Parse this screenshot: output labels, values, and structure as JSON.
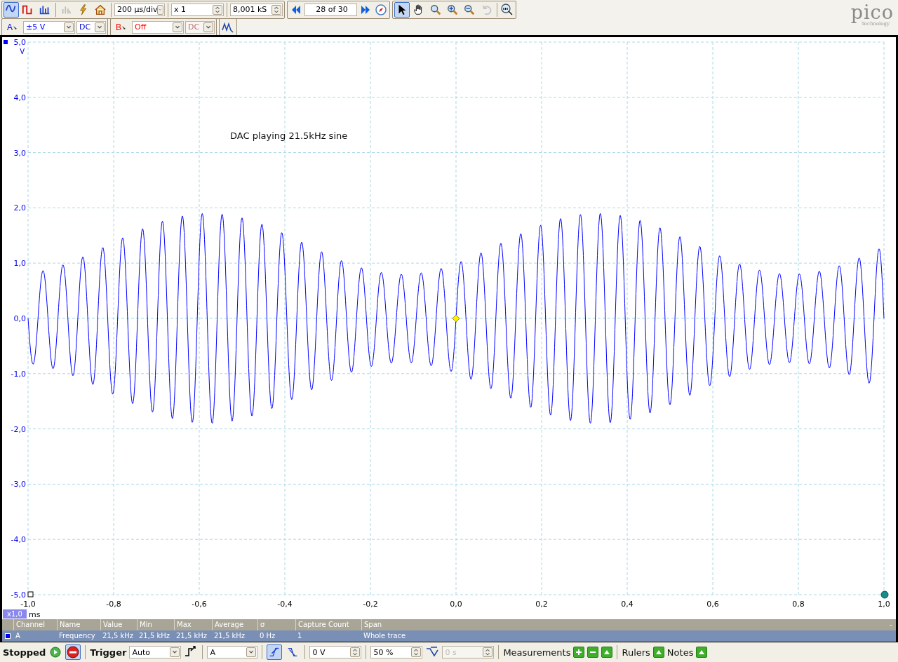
{
  "toolbar": {
    "view_modes": [
      {
        "kind": "scope",
        "selected": true
      },
      {
        "kind": "persistence",
        "selected": false
      },
      {
        "kind": "spectrum",
        "selected": false
      }
    ],
    "tools_a": [
      {
        "kind": "probe",
        "disabled": true
      },
      {
        "kind": "autosetup",
        "disabled": false
      },
      {
        "kind": "home",
        "disabled": false
      }
    ],
    "timebase": "200 µs/div",
    "zoom": "x 1",
    "samples": "8,001 kS",
    "capture": "28 of 30",
    "cursor_tools": [
      {
        "kind": "pointer",
        "selected": true,
        "disabled": false
      },
      {
        "kind": "hand",
        "selected": false,
        "disabled": false
      },
      {
        "kind": "zoom_area",
        "selected": false,
        "disabled": false
      },
      {
        "kind": "zoom_in",
        "selected": false,
        "disabled": false
      },
      {
        "kind": "zoom_out",
        "selected": false,
        "disabled": false
      },
      {
        "kind": "undo",
        "selected": false,
        "disabled": true
      }
    ]
  },
  "logo": {
    "name": "pico",
    "tagline": "Technology"
  },
  "channels": [
    {
      "label": "A",
      "range": "±5 V",
      "coupling": "DC",
      "color": "#0000ff",
      "disabled": false
    },
    {
      "label": "B",
      "range": "Off",
      "coupling": "DC",
      "color": "#ff0000",
      "disabled": true
    }
  ],
  "plot": {
    "y_ticks": [
      "5,0",
      "4,0",
      "3,0",
      "2,0",
      "1,0",
      "0,0",
      "-1,0",
      "-2,0",
      "-3,0",
      "-4,0",
      "-5,0"
    ],
    "y_unit": "V",
    "x_ticks": [
      "-1,0",
      "-0,8",
      "-0,6",
      "-0,4",
      "-0,2",
      "0,0",
      "0,2",
      "0,4",
      "0,6",
      "0,8",
      "1,0"
    ],
    "x_unit": "ms",
    "x_zoom": "x1,0",
    "note": "DAC playing 21.5kHz sine"
  },
  "measurements": {
    "columns": [
      "Channel",
      "Name",
      "Value",
      "Min",
      "Max",
      "Average",
      "σ",
      "Capture Count",
      "Span"
    ],
    "collapse": "-",
    "rows": [
      {
        "selected": true,
        "color": "#0000ff",
        "cells": [
          "A",
          "Frequency",
          "21,5 kHz",
          "21,5 kHz",
          "21,5 kHz",
          "21,5 kHz",
          "0 Hz",
          "1",
          "Whole trace"
        ]
      }
    ]
  },
  "status_bar": {
    "run_state": "Stopped",
    "running": false,
    "trigger_label": "Trigger",
    "trigger_mode": "Auto",
    "trigger_source": "A",
    "edges": [
      {
        "kind": "rising",
        "selected": true
      },
      {
        "kind": "falling",
        "selected": false
      }
    ],
    "threshold": "0 V",
    "pre_trigger": "50 %",
    "delay": {
      "value": "0 s",
      "disabled": true
    },
    "measurements_label": "Measurements",
    "rulers_label": "Rulers",
    "notes_label": "Notes"
  }
}
